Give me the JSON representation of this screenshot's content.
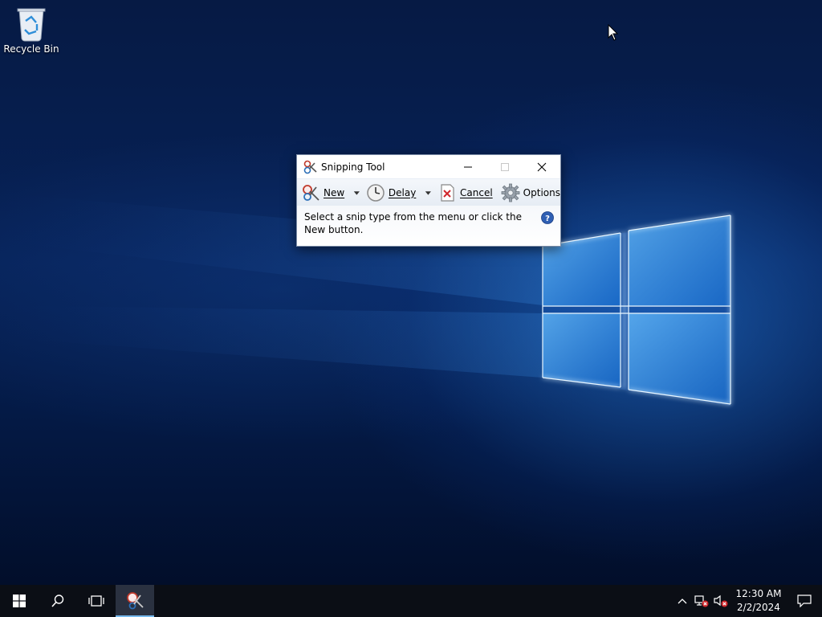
{
  "desktop": {
    "icons": [
      {
        "label": "Recycle Bin",
        "icon": "recycle-bin-icon"
      }
    ]
  },
  "window": {
    "title": "Snipping Tool",
    "app_icon": "scissors-icon",
    "controls": {
      "minimize": "minimize-icon",
      "maximize": "maximize-icon",
      "close": "close-icon"
    },
    "toolbar": {
      "new_label": "New",
      "delay_label": "Delay",
      "cancel_label": "Cancel",
      "options_label": "Options"
    },
    "message": "Select a snip type from the menu or click the New button.",
    "help_icon": "help-icon"
  },
  "taskbar": {
    "start_icon": "windows-start-icon",
    "search_icon": "search-icon",
    "task_view_icon": "task-view-icon",
    "pinned_app": "snipping-tool-icon",
    "tray": {
      "chevron": "chevron-up-icon",
      "network": "network-disconnected-icon",
      "volume": "volume-muted-icon"
    },
    "clock": {
      "time": "12:30 AM",
      "date": "2/2/2024"
    },
    "notification_icon": "action-center-icon"
  },
  "colors": {
    "wallpaper_dark": "#061a44",
    "wallpaper_glow": "#2882e6",
    "taskbar": "#0b0e15",
    "accent": "#76b9ed"
  }
}
